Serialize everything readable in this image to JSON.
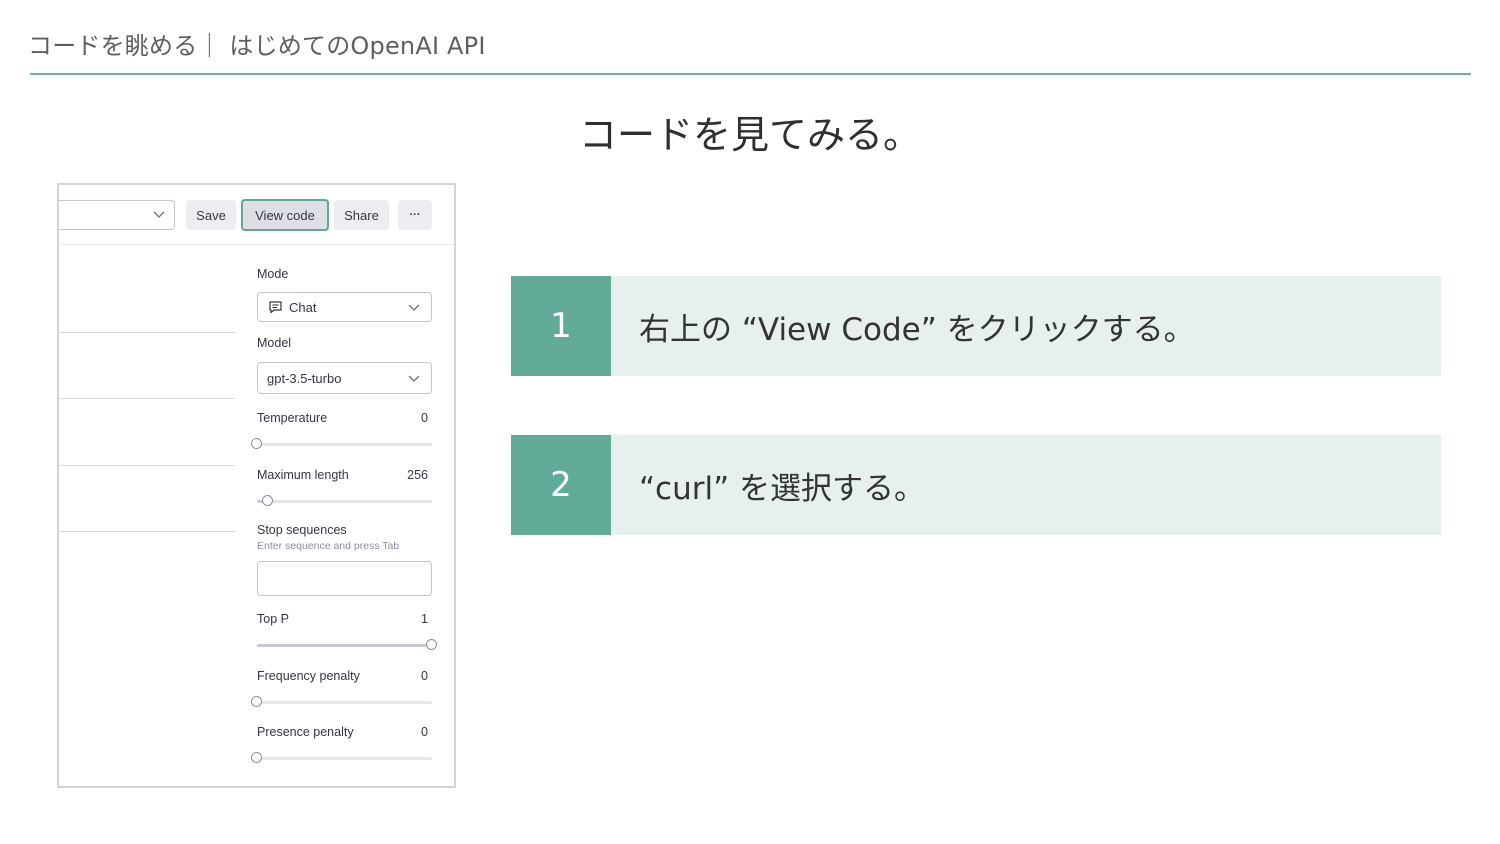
{
  "header": {
    "title": "コードを眺める｜ はじめてのOpenAI API",
    "rule_color": "#6db4a0"
  },
  "slide": {
    "title": "コードを見てみる。"
  },
  "playground": {
    "toolbar": {
      "save_label": "Save",
      "view_code_label": "View code",
      "share_label": "Share",
      "more_label": "···"
    },
    "mode": {
      "label": "Mode",
      "value": "Chat",
      "icon": "chat-bubble-icon"
    },
    "model": {
      "label": "Model",
      "value": "gpt-3.5-turbo"
    },
    "temperature": {
      "label": "Temperature",
      "value": "0",
      "level": 0
    },
    "maximum_length": {
      "label": "Maximum length",
      "value": "256",
      "level": 0.06
    },
    "stop_sequences": {
      "label": "Stop sequences",
      "hint": "Enter sequence and press Tab",
      "value": ""
    },
    "top_p": {
      "label": "Top P",
      "value": "1",
      "level": 1
    },
    "frequency_penalty": {
      "label": "Frequency penalty",
      "value": "0",
      "level": 0
    },
    "presence_penalty": {
      "label": "Presence penalty",
      "value": "0",
      "level": 0
    },
    "highlight_color": "#5fa994"
  },
  "steps": [
    {
      "number": "1",
      "text": "右上の “View Code” をクリックする。"
    },
    {
      "number": "2",
      "text": "“curl” を選択する。"
    }
  ],
  "colors": {
    "accent": "#62ab99",
    "step_background": "#e6f0ee"
  }
}
